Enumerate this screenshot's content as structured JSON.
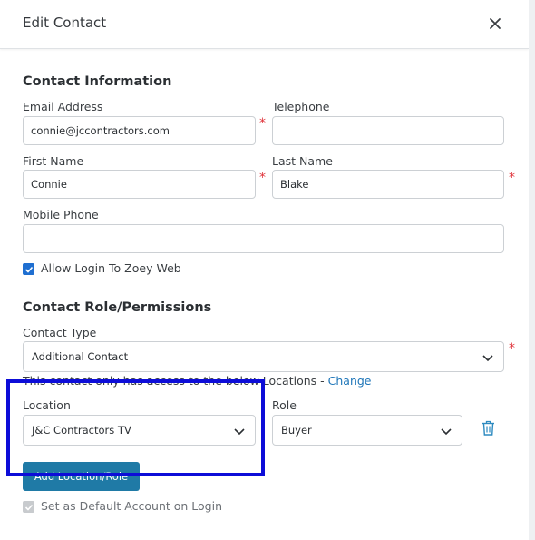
{
  "modal": {
    "title": "Edit Contact",
    "close_icon": "close-icon"
  },
  "contact_info": {
    "heading": "Contact Information",
    "email": {
      "label": "Email Address",
      "value": "connie@jccontractors.com",
      "required": true
    },
    "telephone": {
      "label": "Telephone",
      "value": ""
    },
    "first_name": {
      "label": "First Name",
      "value": "Connie",
      "required": true
    },
    "last_name": {
      "label": "Last Name",
      "value": "Blake",
      "required": true
    },
    "mobile": {
      "label": "Mobile Phone",
      "value": ""
    },
    "allow_login": {
      "label": "Allow Login To Zoey Web",
      "checked": true
    }
  },
  "role_permissions": {
    "heading": "Contact Role/Permissions",
    "contact_type": {
      "label": "Contact Type",
      "value": "Additional Contact",
      "required": true
    },
    "access_note": "This contact only has access to the below Locations - ",
    "access_link": "Change",
    "location": {
      "label": "Location",
      "value": "J&C Contractors TV"
    },
    "role": {
      "label": "Role",
      "value": "Buyer"
    },
    "delete_icon": "trash-icon",
    "add_button": "Add Location/Role",
    "default_account": {
      "label": "Set as Default Account on Login",
      "checked": true,
      "disabled": true
    }
  },
  "colors": {
    "accent": "#1f7aa6",
    "checkbox": "#1f6fd1",
    "link": "#1d75b8",
    "required": "#e0323a",
    "highlight_box": "#0d0dd8"
  }
}
